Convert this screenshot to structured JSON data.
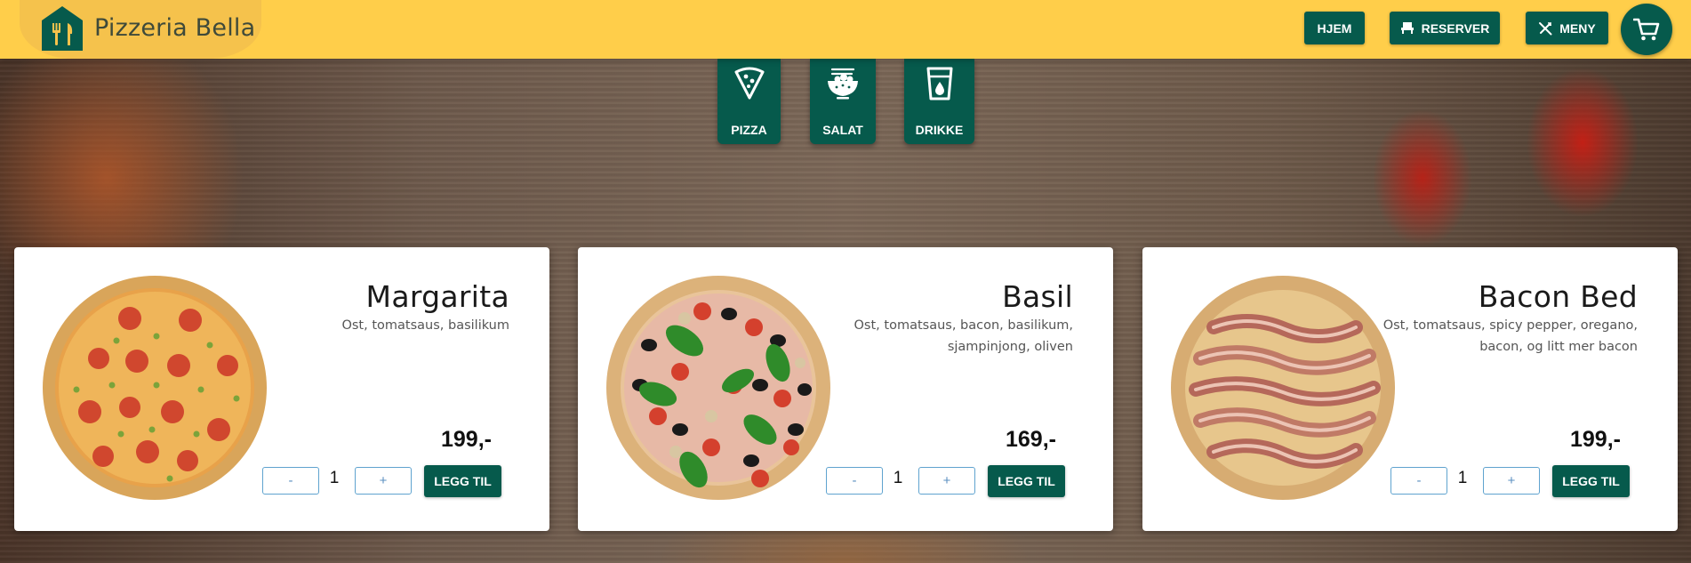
{
  "brand": {
    "name": "Pizzeria Bella",
    "logo_icon": "restaurant-house-icon"
  },
  "nav": {
    "home_label": "HJEM",
    "reserve_label": "RESERVER",
    "reserve_icon": "seat-icon",
    "menu_label": "MENY",
    "menu_icon": "utensils-icon",
    "cart_icon": "cart-icon"
  },
  "categories": [
    {
      "label": "PIZZA",
      "icon": "pizza-slice-icon"
    },
    {
      "label": "SALAT",
      "icon": "salad-bowl-icon"
    },
    {
      "label": "DRIKKE",
      "icon": "drink-cup-icon"
    }
  ],
  "products": [
    {
      "name": "Margarita",
      "description": "Ost, tomatsaus, basilikum",
      "price": "199,-",
      "quantity": "1",
      "minus": "-",
      "plus": "+",
      "add_label": "LEGG TIL"
    },
    {
      "name": "Basil",
      "description": "Ost, tomatsaus, bacon, basilikum, sjampinjong, oliven",
      "price": "169,-",
      "quantity": "1",
      "minus": "-",
      "plus": "+",
      "add_label": "LEGG TIL"
    },
    {
      "name": "Bacon Bed",
      "description": "Ost, tomatsaus, spicy pepper, oregano, bacon, og litt mer bacon",
      "price": "199,-",
      "quantity": "1",
      "minus": "-",
      "plus": "+",
      "add_label": "LEGG TIL"
    }
  ],
  "colors": {
    "header_bg": "#ffce4a",
    "accent": "#065a4c",
    "card_bg": "#ffffff"
  }
}
